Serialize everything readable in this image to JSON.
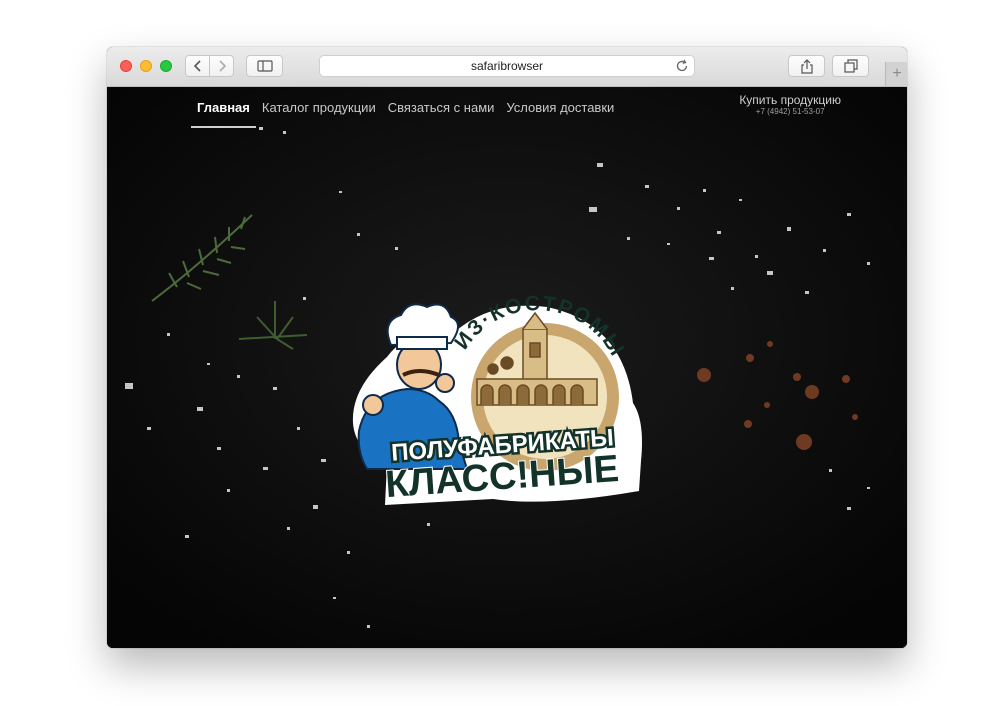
{
  "browser": {
    "address": "safaribrowser",
    "buttons": {
      "back": "chevron-left-icon",
      "forward": "chevron-right-icon",
      "sidebar": "sidebar-icon",
      "reload": "reload-icon",
      "share": "share-icon",
      "tabs": "tabs-icon",
      "new_tab": "+"
    },
    "traffic_lights": {
      "close": "#fc5f57",
      "minimize": "#fdbc2e",
      "zoom": "#28c840"
    }
  },
  "site": {
    "nav": {
      "items": [
        {
          "label": "Главная",
          "active": true
        },
        {
          "label": "Каталог продукции",
          "active": false
        },
        {
          "label": "Связаться с нами",
          "active": false
        },
        {
          "label": "Условия доставки",
          "active": false
        }
      ]
    },
    "buy": {
      "label": "Купить продукцию",
      "phone": "+7 (4942) 51-53-07"
    },
    "logo": {
      "arc_text": "ИЗ·КОСТРОМЫ",
      "line1": "ПОЛУФАБРИКАТЫ",
      "line2": "КЛАСС!НЫЕ",
      "colors": {
        "dark_green": "#13332a",
        "chef_blue": "#1a72c2",
        "sepia": "#c9a66d"
      }
    },
    "background_color": "#0b0b0b"
  }
}
